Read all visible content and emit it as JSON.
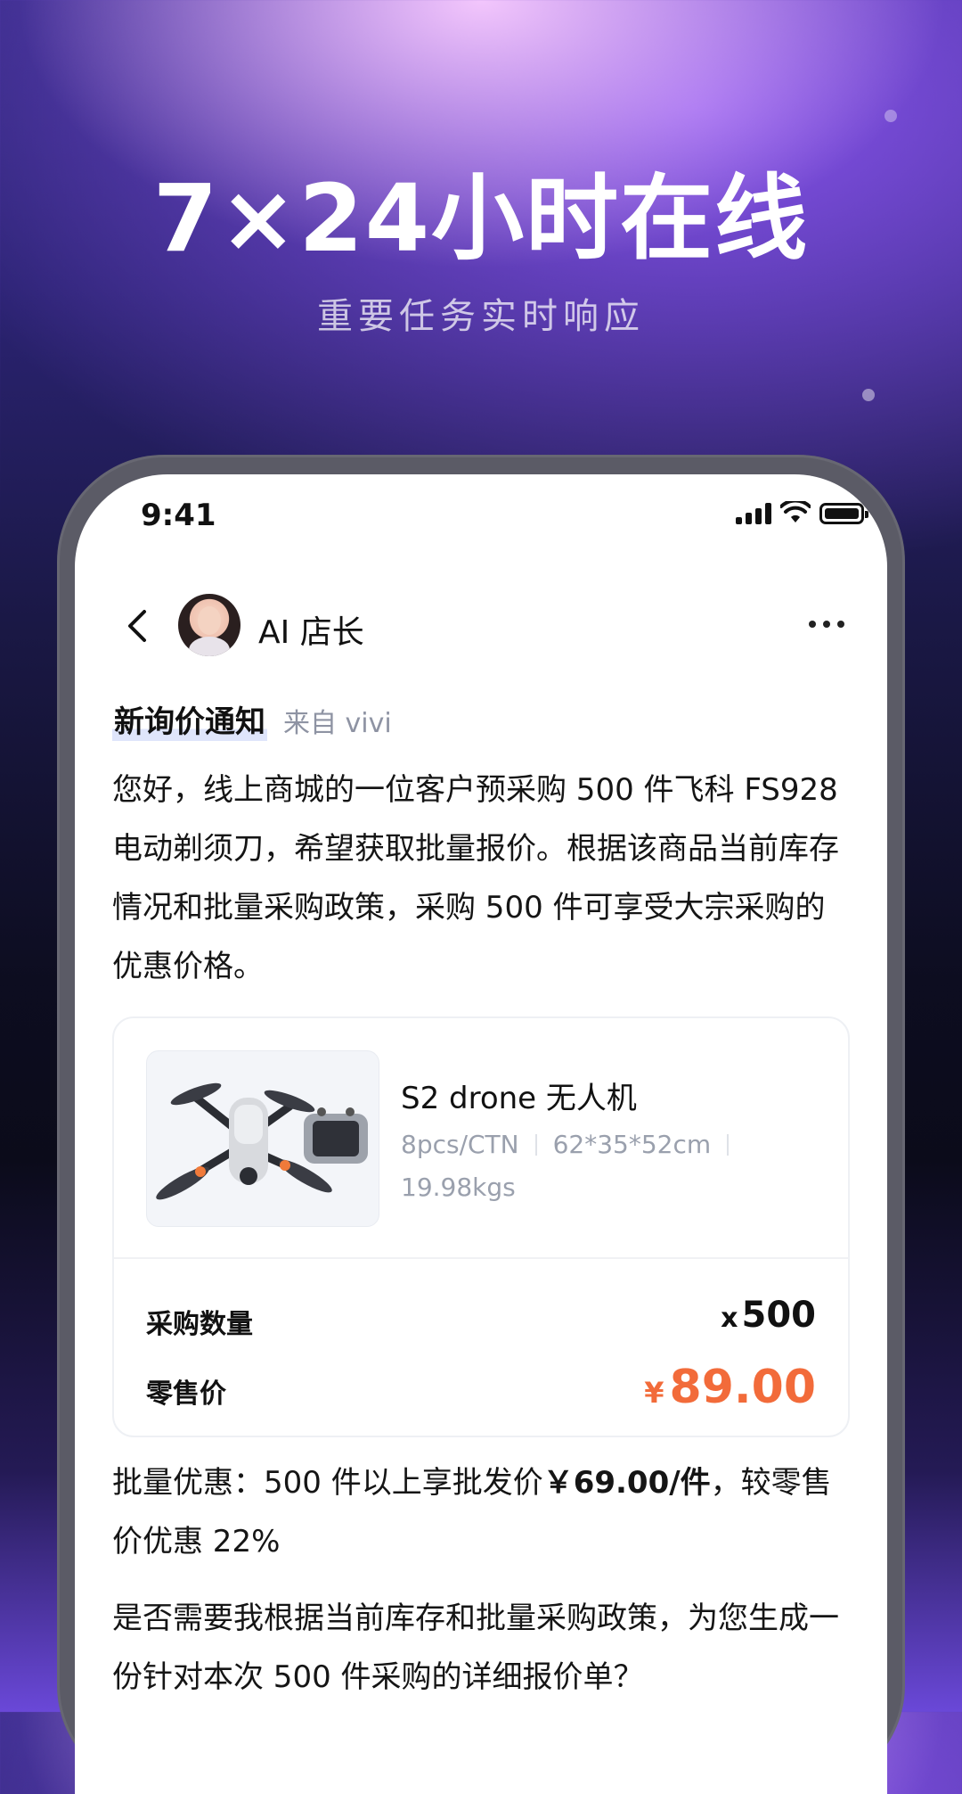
{
  "hero": {
    "title": "7×24小时在线",
    "subtitle": "重要任务实时响应"
  },
  "status_bar": {
    "time": "9:41"
  },
  "chat_header": {
    "name": "AI 店长"
  },
  "message": {
    "notice_title": "新询价通知",
    "notice_from": "来自 vivi",
    "intro": "您好，线上商城的一位客户预采购 500 件飞科 FS928 电动剃须刀，希望获取批量报价。根据该商品当前库存情况和批量采购政策，采购 500 件可享受大宗采购的优惠价格。"
  },
  "product": {
    "name": "S2 drone 无人机",
    "spec_pack": "8pcs/CTN",
    "spec_size": "62*35*52cm",
    "spec_weight": "19.98kgs",
    "qty_label": "采购数量",
    "qty_prefix": "x",
    "qty_value": "500",
    "price_label": "零售价",
    "currency": "¥",
    "price_value": "89.00"
  },
  "discount": {
    "prefix": "批量优惠：500 件以上享批发价",
    "price": "￥69.00/件",
    "suffix": "，较零售价优惠 22%"
  },
  "question": "是否需要我根据当前库存和批量采购政策，为您生成一份针对本次 500 件采购的详细报价单？",
  "colors": {
    "price_accent": "#f26b3a",
    "highlight": "#dfe5fb"
  }
}
